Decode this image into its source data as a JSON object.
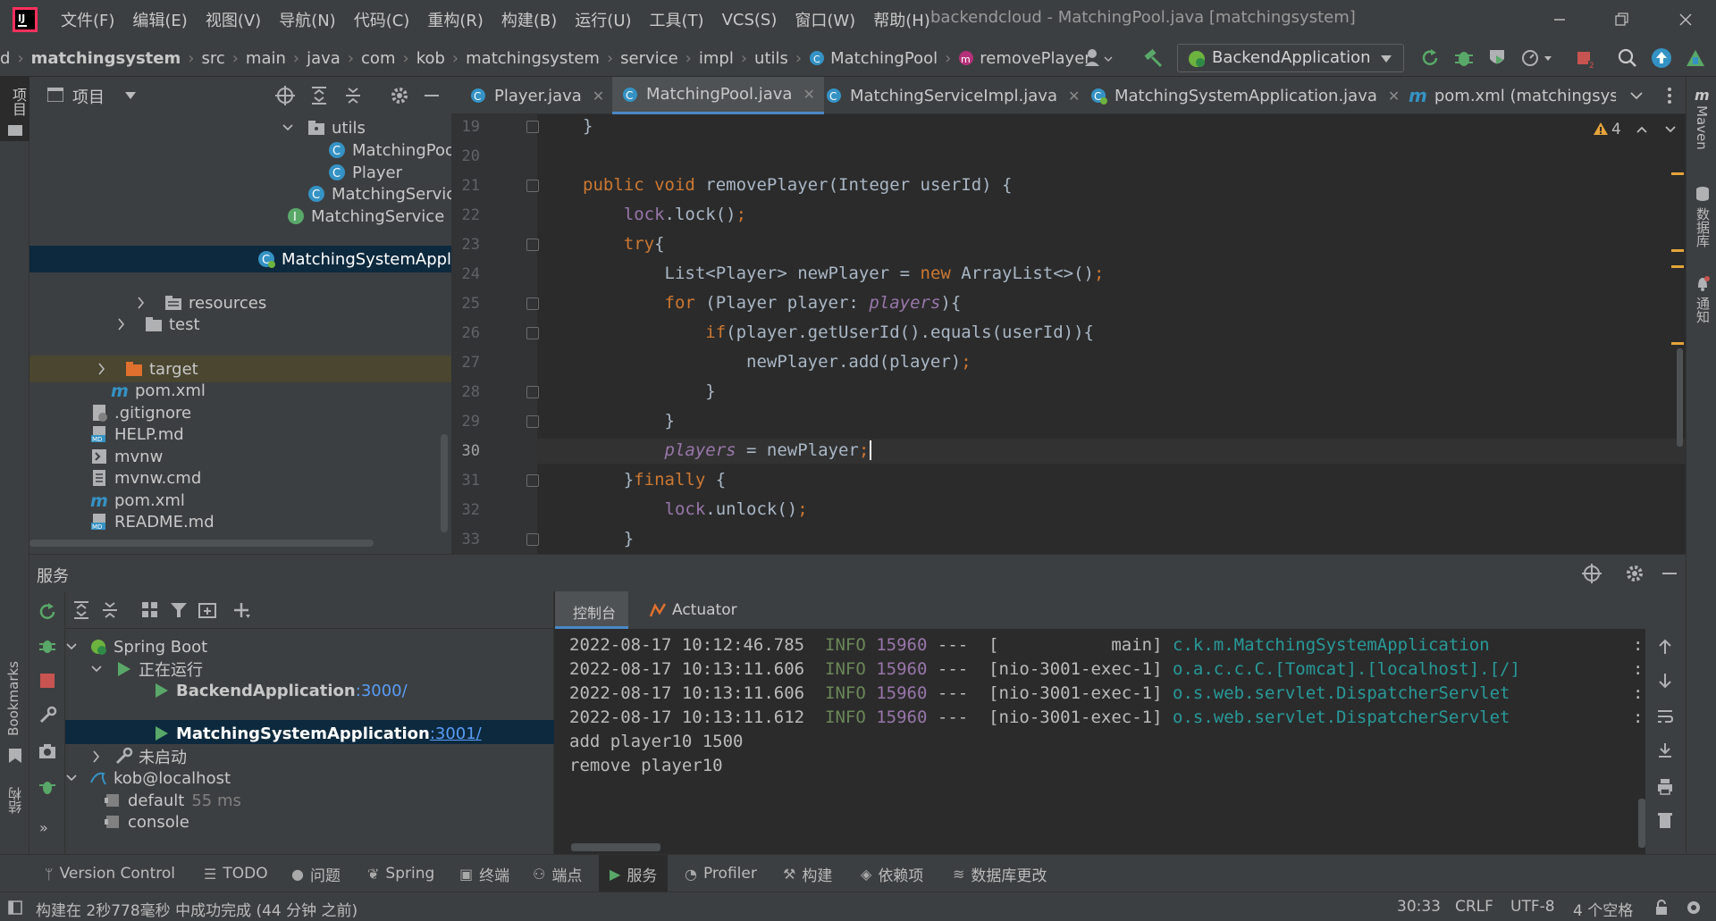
{
  "menubar": {
    "items": [
      "文件(F)",
      "编辑(E)",
      "视图(V)",
      "导航(N)",
      "代码(C)",
      "重构(R)",
      "构建(B)",
      "运行(U)",
      "工具(T)",
      "VCS(S)",
      "窗口(W)",
      "帮助(H)"
    ],
    "window_title": "backendcloud - MatchingPool.java [matchingsystem]"
  },
  "navbar": {
    "crumbs": [
      "d",
      "matchingsystem",
      "src",
      "main",
      "java",
      "com",
      "kob",
      "matchingsystem",
      "service",
      "impl",
      "utils",
      "MatchingPool",
      "removePlayer"
    ],
    "run_config": "BackendApplication"
  },
  "project": {
    "title": "项目",
    "items": [
      "utils",
      "MatchingPoo",
      "Player",
      "MatchingServic",
      "MatchingService",
      "MatchingSystemAppli",
      "resources",
      "test",
      "target",
      "pom.xml",
      ".gitignore",
      "HELP.md",
      "mvnw",
      "mvnw.cmd",
      "pom.xml",
      "README.md"
    ]
  },
  "left_stripe": {
    "project_label": "项目",
    "bookmarks": "Bookmarks",
    "structure": "结构"
  },
  "right_stripe": {
    "maven": "Maven",
    "database": "数据库",
    "notifications": "通知"
  },
  "tabs": [
    "Player.java",
    "MatchingPool.java",
    "MatchingServiceImpl.java",
    "MatchingSystemApplication.java",
    "pom.xml (matchingsyst"
  ],
  "editor": {
    "warnings": "4",
    "line_numbers": [
      "19",
      "20",
      "21",
      "22",
      "23",
      "24",
      "25",
      "26",
      "27",
      "28",
      "29",
      "30",
      "31",
      "32",
      "33"
    ],
    "current_line": "30"
  },
  "services": {
    "title": "服务",
    "tree": {
      "spring_boot": "Spring Boot",
      "running": "正在运行",
      "app1": "BackendApplication",
      "app1_port": ":3000/",
      "app2": "MatchingSystemApplication",
      "app2_port": ":3001/",
      "not_started": "未启动",
      "db": "kob@localhost",
      "db_default": "default",
      "db_default_time": "55 ms",
      "db_console": "console"
    },
    "console_tabs": [
      "控制台",
      "Actuator"
    ],
    "log": [
      {
        "ts": "2022-08-17 10:12:46.785",
        "level": "INFO",
        "pid": "15960",
        "thread": "---  [           main]",
        "logger": "c.k.m.MatchingSystemApplication",
        "tail": ":"
      },
      {
        "ts": "2022-08-17 10:13:11.606",
        "level": "INFO",
        "pid": "15960",
        "thread": "---  [nio-3001-exec-1]",
        "logger": "o.a.c.c.C.[Tomcat].[localhost].[/]",
        "tail": ":"
      },
      {
        "ts": "2022-08-17 10:13:11.606",
        "level": "INFO",
        "pid": "15960",
        "thread": "---  [nio-3001-exec-1]",
        "logger": "o.s.web.servlet.DispatcherServlet",
        "tail": ":"
      },
      {
        "ts": "2022-08-17 10:13:11.612",
        "level": "INFO",
        "pid": "15960",
        "thread": "---  [nio-3001-exec-1]",
        "logger": "o.s.web.servlet.DispatcherServlet",
        "tail": ":"
      }
    ],
    "output": [
      "add player10 1500",
      "remove player10"
    ]
  },
  "bottom_tools": [
    "Version Control",
    "TODO",
    "问题",
    "Spring",
    "终端",
    "端点",
    "服务",
    "Profiler",
    "构建",
    "依赖项",
    "数据库更改"
  ],
  "status": {
    "message": "构建在 2秒778毫秒 中成功完成 (44 分钟 之前)",
    "position": "30:33",
    "line_sep": "CRLF",
    "encoding": "UTF-8",
    "indent": "4 个空格"
  },
  "colors": {
    "accent": "#4a88c7",
    "selection": "#0d293e",
    "keyword": "#cc7832",
    "field": "#9876aa",
    "method": "#ffc66d",
    "run_green": "#59a869",
    "stop_red": "#c75450"
  }
}
